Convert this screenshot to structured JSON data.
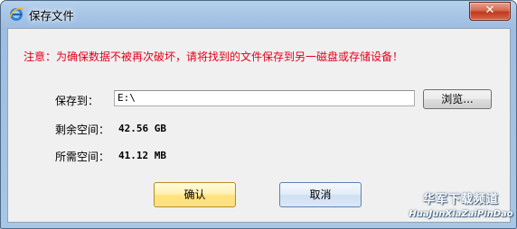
{
  "window": {
    "title": "保存文件",
    "close_glyph": "✕"
  },
  "dialog": {
    "warning": "注意：为确保数据不被再次破坏，请将找到的文件保存到另一磁盘或存储设备！",
    "save_to_label": "保存到：",
    "save_to_value": "E:\\",
    "browse_label": "浏览...",
    "free_space_label": "剩余空间：",
    "free_space_value": "42.56 GB",
    "required_space_label": "所需空间：",
    "required_space_value": "41.12 MB",
    "ok_label": "确认",
    "cancel_label": "取消"
  },
  "watermark": {
    "line1": "华军下载频道",
    "line2": "HuaJunXiaZaiPinDao"
  },
  "icons": {
    "app": "ie-globe-icon",
    "close": "close-icon"
  },
  "colors": {
    "warning_text": "#e3001b",
    "close_button": "#c0391b",
    "title_bar": "#a9c6e6"
  }
}
